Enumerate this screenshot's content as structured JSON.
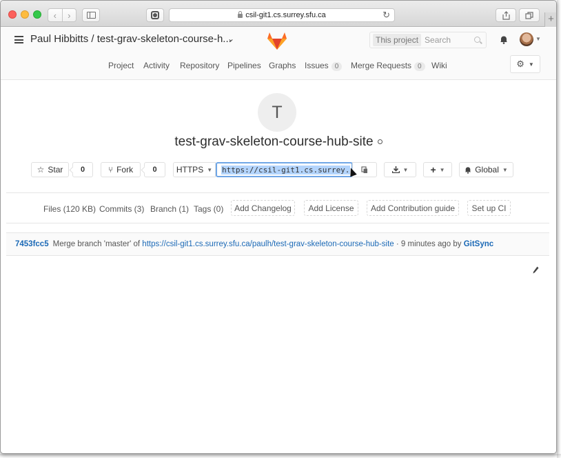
{
  "browser": {
    "address": "csil-git1.cs.surrey.sfu.ca",
    "new_tab_glyph": "+"
  },
  "header": {
    "project_path": "Paul Hibbitts / test-grav-skeleton-course-h...",
    "search_scope": "This project",
    "search_placeholder": "Search"
  },
  "nav": {
    "items": [
      {
        "label": "Project"
      },
      {
        "label": "Activity"
      },
      {
        "label": "Repository"
      },
      {
        "label": "Pipelines"
      },
      {
        "label": "Graphs"
      },
      {
        "label": "Issues",
        "count": "0"
      },
      {
        "label": "Merge Requests",
        "count": "0"
      },
      {
        "label": "Wiki"
      }
    ]
  },
  "project": {
    "avatar_letter": "T",
    "title": "test-grav-skeleton-course-hub-site",
    "star_label": "Star",
    "star_count": "0",
    "fork_label": "Fork",
    "fork_count": "0",
    "protocol": "HTTPS",
    "clone_url": "https://csil-git1.cs.surrey.",
    "notification_level": "Global"
  },
  "stats": {
    "files": "Files (120 KB)",
    "commits": "Commits (3)",
    "branch": "Branch (1)",
    "tags": "Tags (0)",
    "add_changelog": "Add Changelog",
    "add_license": "Add License",
    "add_contribution": "Add Contribution guide",
    "setup_ci": "Set up CI"
  },
  "commit": {
    "sha": "7453fcc5",
    "message_prefix": "Merge branch 'master' of",
    "link": "https://csil-git1.cs.surrey.sfu.ca/paulh/test-grav-skeleton-course-hub-site",
    "time": "· 9 minutes ago by",
    "author": "GitSync"
  },
  "colors": {
    "link": "#1b69b6",
    "selection": "#b3d4fc",
    "fox_orange": "#e24329"
  }
}
